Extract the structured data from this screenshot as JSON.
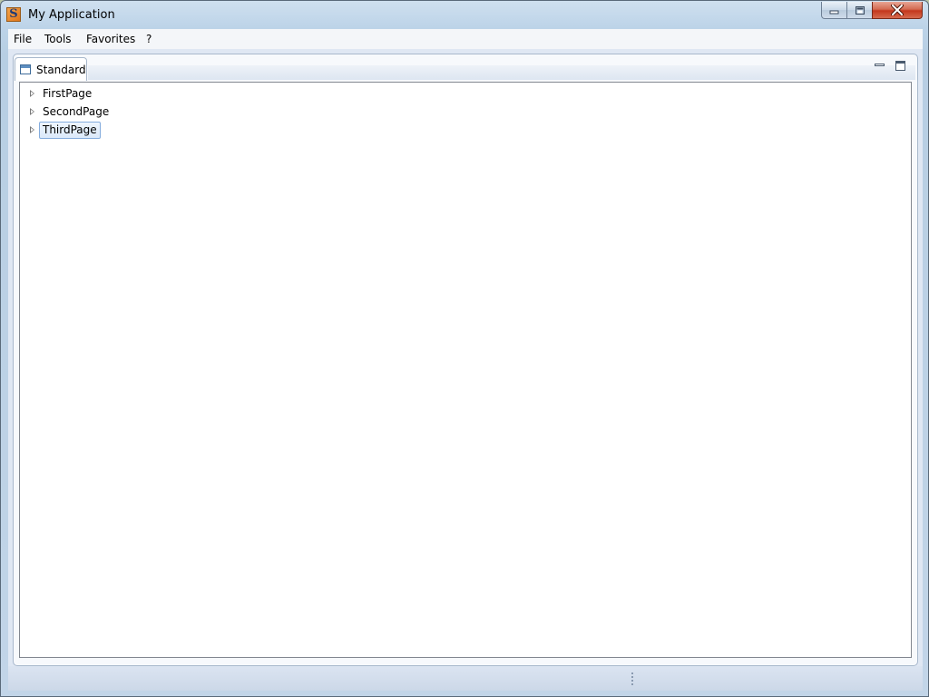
{
  "window": {
    "title": "My Application",
    "app_icon_glyph": "S",
    "icons": {
      "minimize": "minimize-icon",
      "maximize": "maximize-icon",
      "close": "close-icon"
    }
  },
  "menubar": {
    "items": [
      {
        "label": "File"
      },
      {
        "label": "Tools"
      },
      {
        "label": "Favorites"
      },
      {
        "label": "?"
      }
    ]
  },
  "panel": {
    "tab": {
      "label": "Standard",
      "icon": "window-icon"
    },
    "controls": {
      "minimize": "panel-minimize-icon",
      "maximize": "panel-maximize-icon"
    }
  },
  "tree": {
    "items": [
      {
        "label": "FirstPage",
        "selected": false
      },
      {
        "label": "SecondPage",
        "selected": false
      },
      {
        "label": "ThirdPage",
        "selected": true
      }
    ]
  },
  "colors": {
    "selection_border": "#84acdd",
    "selection_fill": "#dbe9fa",
    "close_button": "#c4371c"
  }
}
